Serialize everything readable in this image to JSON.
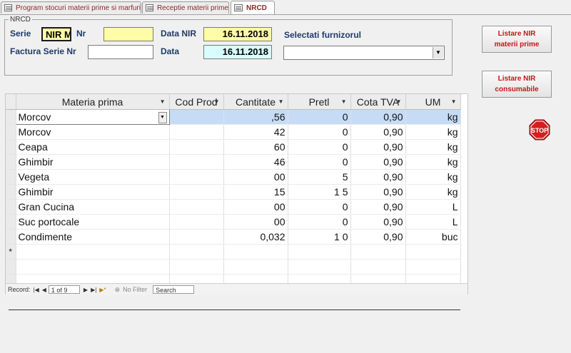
{
  "tabs": [
    {
      "label": "Program stocuri materii prime si marfuri"
    },
    {
      "label": "Receptie materii prime"
    },
    {
      "label": "NRCD"
    }
  ],
  "header": {
    "legend": "NRCD",
    "serie_label": "Serie",
    "serie_value": "NIR M",
    "nr_label": "Nr",
    "nr_value": "",
    "data_nir_label": "Data NIR",
    "data_nir_value": "16.11.2018",
    "selectati_label": "Selectati furnizorul",
    "factura_label": "Factura Serie Nr",
    "factura_value": "",
    "data_label": "Data",
    "data_value": "16.11.2018",
    "furnizor_value": ""
  },
  "buttons": {
    "listare_mp_line1": "Listare NIR",
    "listare_mp_line2": "materii prime",
    "listare_c_line1": "Listare NIR",
    "listare_c_line2": "consumabile",
    "stop_label": "STOP"
  },
  "grid": {
    "columns": [
      "Materia prima",
      "Cod Prod",
      "Cantitate",
      "Pretl",
      "Cota TVA",
      "UM"
    ],
    "rows": [
      {
        "materia": "Morcov",
        "cod": "",
        "cantitate": ",56",
        "pret": "0",
        "tva": "0,90",
        "um": "kg"
      },
      {
        "materia": "Morcov",
        "cod": "",
        "cantitate": "42",
        "pret": "0",
        "tva": "0,90",
        "um": "kg"
      },
      {
        "materia": "Ceapa",
        "cod": "",
        "cantitate": "60",
        "pret": "0",
        "tva": "0,90",
        "um": "kg"
      },
      {
        "materia": "Ghimbir",
        "cod": "",
        "cantitate": "46",
        "pret": "0",
        "tva": "0,90",
        "um": "kg"
      },
      {
        "materia": "Vegeta",
        "cod": "",
        "cantitate": "00",
        "pret": "5",
        "tva": "0,90",
        "um": "kg"
      },
      {
        "materia": "Ghimbir",
        "cod": "",
        "cantitate": "15",
        "pret": "1 5",
        "tva": "0,90",
        "um": "kg"
      },
      {
        "materia": "Gran Cucina",
        "cod": "",
        "cantitate": "00",
        "pret": "0",
        "tva": "0,90",
        "um": "L"
      },
      {
        "materia": "Suc portocale",
        "cod": "",
        "cantitate": "00",
        "pret": "0",
        "tva": "0,90",
        "um": "L"
      },
      {
        "materia": "Condimente",
        "cod": "",
        "cantitate": "0,032",
        "pret": "1 0",
        "tva": "0,90",
        "um": "buc"
      }
    ],
    "new_row_marker": "*"
  },
  "navigation": {
    "record_label": "Record:",
    "record_position": "1 of 9",
    "no_filter": "No Filter",
    "search_placeholder": "Search"
  },
  "colors": {
    "label_text": "#1f3a6b",
    "button_text": "#c01818",
    "highlight_row": "#c6dcf6",
    "yellow_field": "#fffca8",
    "cyan_field": "#d8fdfd"
  }
}
